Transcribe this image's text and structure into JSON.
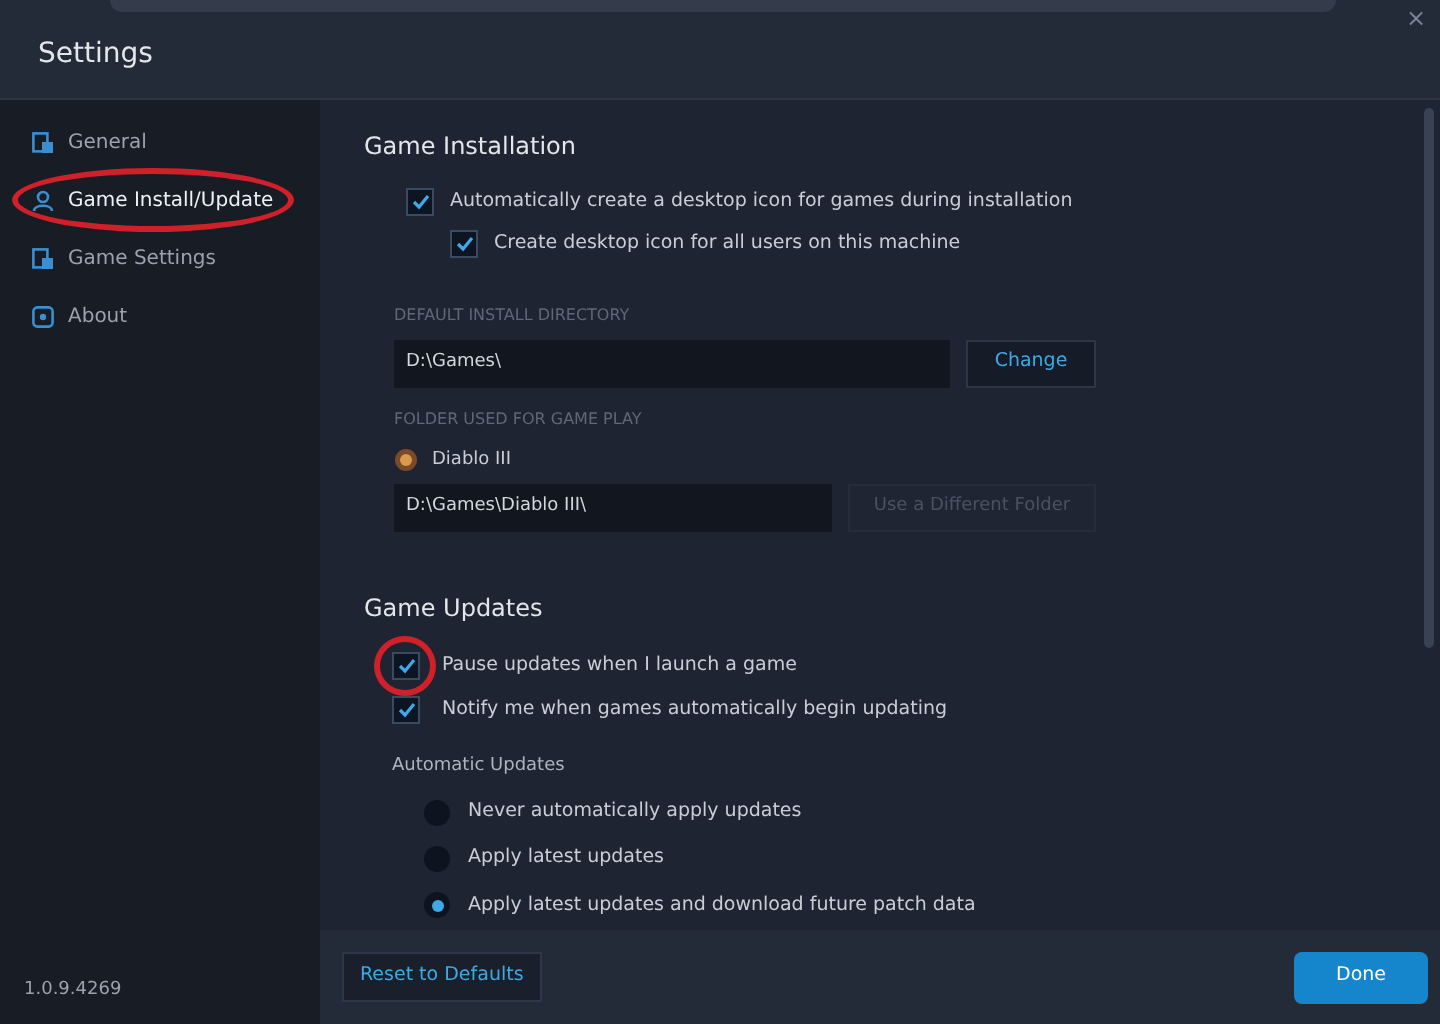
{
  "window": {
    "title": "Settings",
    "close": "×"
  },
  "sidebar": {
    "items": [
      {
        "label": "General",
        "selected": false,
        "highlighted": false
      },
      {
        "label": "Game Install/Update",
        "selected": true,
        "highlighted": true
      },
      {
        "label": "Game Settings",
        "selected": false,
        "highlighted": false
      },
      {
        "label": "About",
        "selected": false,
        "highlighted": false
      }
    ],
    "version": "1.0.9.4269"
  },
  "installation": {
    "title": "Game Installation",
    "options": [
      {
        "label": "Automatically create a desktop icon for games during installation",
        "checked": true,
        "indented": false
      },
      {
        "label": "Create desktop icon for all users on this machine",
        "checked": true,
        "indented": true
      }
    ],
    "install_dir": {
      "label": "DEFAULT INSTALL DIRECTORY",
      "value": "D:\\Games\\",
      "button": "Change"
    },
    "game_folder": {
      "label": "FOLDER USED FOR GAME PLAY",
      "game": "Diablo III",
      "value": "D:\\Games\\Diablo III\\",
      "button": "Use a Different Folder",
      "button_disabled": true
    }
  },
  "updates": {
    "title": "Game Updates",
    "options": [
      {
        "label": "Pause updates when I launch a game",
        "checked": true,
        "highlighted": true
      },
      {
        "label": "Notify me when games automatically begin updating",
        "checked": true,
        "highlighted": false
      }
    ],
    "automatic": {
      "label": "Automatic Updates",
      "choices": [
        {
          "label": "Never automatically apply updates",
          "selected": false
        },
        {
          "label": "Apply latest updates",
          "selected": false
        },
        {
          "label": "Apply latest updates and download future patch data",
          "selected": true
        }
      ]
    }
  },
  "footer": {
    "reset": "Reset to Defaults",
    "done": "Done"
  }
}
